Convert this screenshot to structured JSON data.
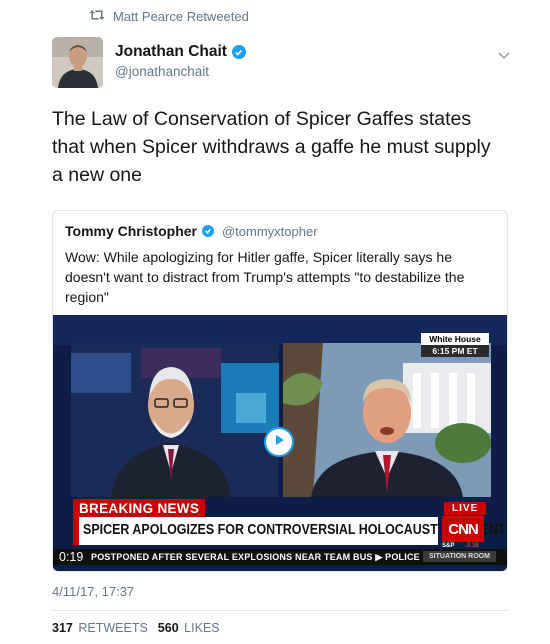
{
  "retweet_context": {
    "icon": "retweet-icon",
    "text": "Matt Pearce Retweeted"
  },
  "tweet": {
    "author_name": "Jonathan Chait",
    "author_handle": "@jonathanchait",
    "verified": true,
    "text": "The Law of Conservation of Spicer Gaffes states that when Spicer withdraws a gaffe he must supply a new one",
    "timestamp": "4/11/17, 17:37",
    "retweets_count": "317",
    "retweets_label": "RETWEETS",
    "likes_count": "560",
    "likes_label": "LIKES"
  },
  "quoted_tweet": {
    "author_name": "Tommy Christopher",
    "author_handle": "@tommyxtopher",
    "verified": true,
    "text": "Wow: While apologizing for Hitler gaffe, Spicer literally says he doesn't want to distract from Trump's attempts \"to destabilize the region\""
  },
  "video": {
    "badge_top": "White House",
    "badge_bottom": "6:15 PM ET",
    "breaking_label": "BREAKING NEWS",
    "live_label": "LIVE",
    "headline": "SPICER APOLOGIZES FOR CONTROVERSIAL HOLOCAUST COMMENTS",
    "network_logo": "CNN",
    "market_label": "S&P",
    "market_value": "-3.38",
    "elapsed_time": "0:19",
    "ticker": "POSTPONED AFTER SEVERAL EXPLOSIONS NEAR TEAM BUS  ▶ POLICE",
    "show_tag": "SITUATION ROOM"
  },
  "colors": {
    "accent_blue": "#1da1f2",
    "muted_gray": "#657786",
    "cnn_red": "#cc0000"
  }
}
